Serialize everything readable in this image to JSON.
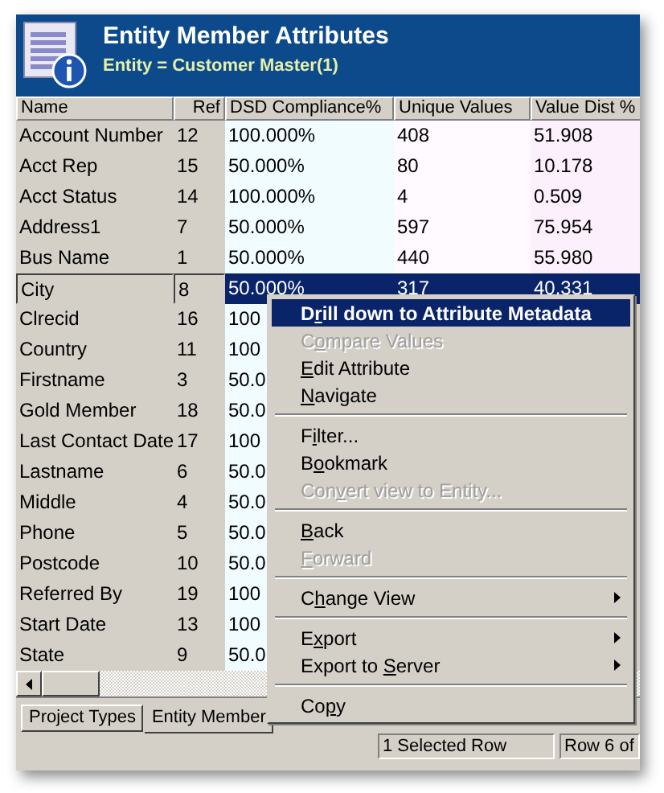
{
  "header": {
    "title": "Entity Member Attributes",
    "subtitle": "Entity = Customer Master(1)"
  },
  "table": {
    "columns": [
      "Name",
      "Ref",
      "DSD Compliance%",
      "Unique Values",
      "Value Dist %"
    ],
    "rows": [
      {
        "cells": [
          "Account Number",
          "12",
          "100.000%",
          "408",
          "51.908"
        ],
        "selected": false
      },
      {
        "cells": [
          "Acct Rep",
          "15",
          "50.000%",
          "80",
          "10.178"
        ],
        "selected": false
      },
      {
        "cells": [
          "Acct Status",
          "14",
          "100.000%",
          "4",
          "0.509"
        ],
        "selected": false
      },
      {
        "cells": [
          "Address1",
          "7",
          "50.000%",
          "597",
          "75.954"
        ],
        "selected": false
      },
      {
        "cells": [
          "Bus Name",
          "1",
          "50.000%",
          "440",
          "55.980"
        ],
        "selected": false
      },
      {
        "cells": [
          "City",
          "8",
          "50.000%",
          "317",
          "40.331"
        ],
        "selected": true
      },
      {
        "cells": [
          "Clrecid",
          "16",
          "100"
        ],
        "selected": false
      },
      {
        "cells": [
          "Country",
          "11",
          "100"
        ],
        "selected": false
      },
      {
        "cells": [
          "Firstname",
          "3",
          "50.0"
        ],
        "selected": false
      },
      {
        "cells": [
          "Gold Member",
          "18",
          "50.0"
        ],
        "selected": false
      },
      {
        "cells": [
          "Last Contact Date",
          "17",
          "100"
        ],
        "selected": false
      },
      {
        "cells": [
          "Lastname",
          "6",
          "50.0"
        ],
        "selected": false
      },
      {
        "cells": [
          "Middle",
          "4",
          "50.0"
        ],
        "selected": false
      },
      {
        "cells": [
          "Phone",
          "5",
          "50.0"
        ],
        "selected": false
      },
      {
        "cells": [
          "Postcode",
          "10",
          "50.0"
        ],
        "selected": false
      },
      {
        "cells": [
          "Referred By",
          "19",
          "100"
        ],
        "selected": false
      },
      {
        "cells": [
          "Start Date",
          "13",
          "100"
        ],
        "selected": false
      },
      {
        "cells": [
          "State",
          "9",
          "50.0"
        ],
        "selected": false
      }
    ]
  },
  "tabs": [
    {
      "label": "Project Types",
      "selected": false
    },
    {
      "label": "Entity Member",
      "selected": true
    }
  ],
  "status_bar": [
    "1 Selected Row",
    "Row 6 of"
  ],
  "context_menu": [
    {
      "kind": "item",
      "pre": "D",
      "key": "r",
      "post": "ill down to Attribute Metadata",
      "selected": true,
      "disabled": false,
      "default": true,
      "submenu": false
    },
    {
      "kind": "item",
      "pre": "C",
      "key": "o",
      "post": "mpare Values",
      "selected": false,
      "disabled": true,
      "default": false,
      "submenu": false
    },
    {
      "kind": "item",
      "key": "E",
      "post": "dit Attribute",
      "selected": false,
      "disabled": false,
      "default": false,
      "submenu": false
    },
    {
      "kind": "item",
      "key": "N",
      "post": "avigate",
      "selected": false,
      "disabled": false,
      "default": false,
      "submenu": false
    },
    {
      "kind": "separator"
    },
    {
      "kind": "item",
      "pre": "F",
      "key": "i",
      "post": "lter...",
      "selected": false,
      "disabled": false,
      "default": false,
      "submenu": false
    },
    {
      "kind": "item",
      "pre": "B",
      "key": "o",
      "post": "okmark",
      "selected": false,
      "disabled": false,
      "default": false,
      "submenu": false
    },
    {
      "kind": "item",
      "pre": "Con",
      "key": "v",
      "post": "ert view to Entity...",
      "selected": false,
      "disabled": true,
      "default": false,
      "submenu": false
    },
    {
      "kind": "separator"
    },
    {
      "kind": "item",
      "key": "B",
      "post": "ack",
      "selected": false,
      "disabled": false,
      "default": false,
      "submenu": false
    },
    {
      "kind": "item",
      "key": "F",
      "post": "orward",
      "selected": false,
      "disabled": true,
      "default": false,
      "submenu": false
    },
    {
      "kind": "separator"
    },
    {
      "kind": "item",
      "pre": "C",
      "key": "h",
      "post": "ange View",
      "selected": false,
      "disabled": false,
      "default": false,
      "submenu": true
    },
    {
      "kind": "separator"
    },
    {
      "kind": "item",
      "pre": "E",
      "key": "x",
      "post": "port",
      "selected": false,
      "disabled": false,
      "default": false,
      "submenu": true
    },
    {
      "kind": "item",
      "pre": "Export to ",
      "key": "S",
      "post": "erver",
      "selected": false,
      "disabled": false,
      "default": false,
      "submenu": true
    },
    {
      "kind": "separator"
    },
    {
      "kind": "item",
      "pre": "Co",
      "key": "p",
      "post": "y",
      "selected": false,
      "disabled": false,
      "default": false,
      "submenu": false
    }
  ]
}
